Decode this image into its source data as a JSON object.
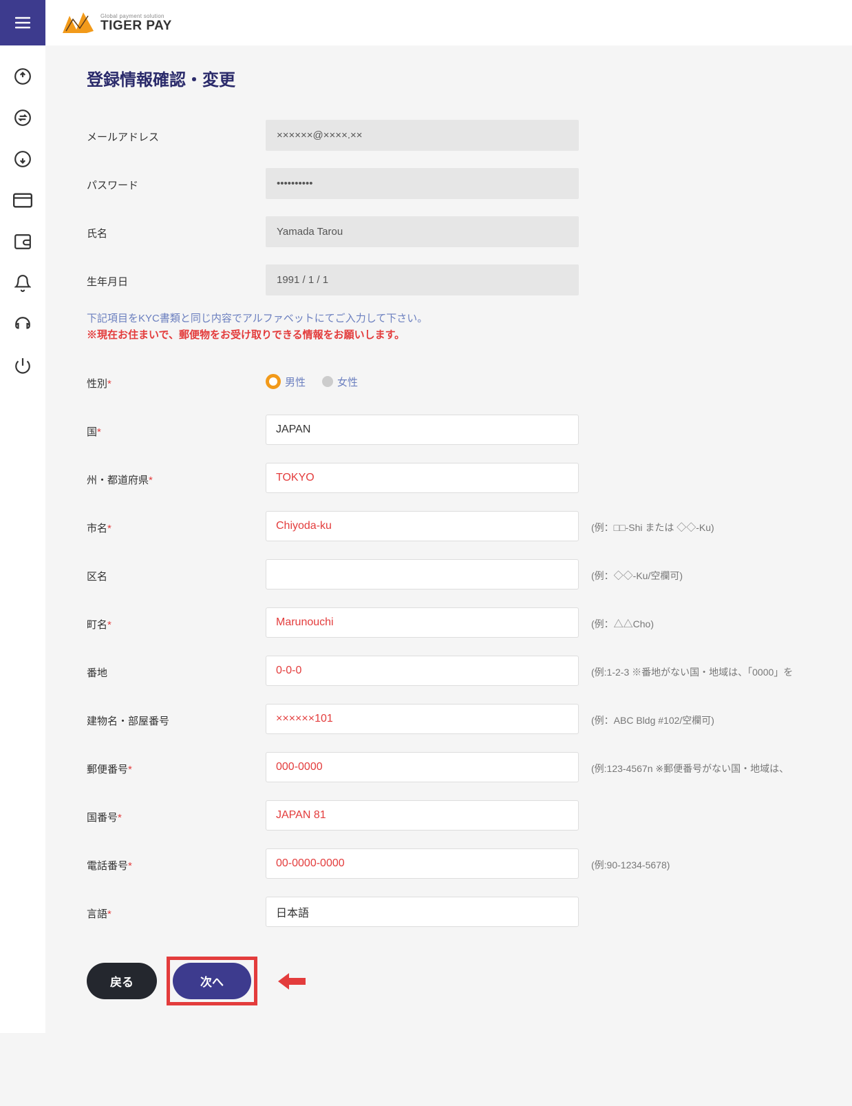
{
  "brand": {
    "tagline": "Global payment solution",
    "name": "TIGER PAY"
  },
  "page_title": "登録情報確認・変更",
  "readonly": {
    "email_label": "メールアドレス",
    "email_value": "××××××@××××.××",
    "password_label": "パスワード",
    "password_value": "••••••••••",
    "name_label": "氏名",
    "name_value": "Yamada Tarou",
    "dob_label": "生年月日",
    "dob_value": "1991 / 1 / 1"
  },
  "notice1": "下記項目をKYC書類と同じ内容でアルファベットにてご入力して下さい。",
  "notice2": "※現在お住まいで、郵便物をお受け取りできる情報をお願いします。",
  "fields": {
    "gender_label": "性別",
    "gender_male": "男性",
    "gender_female": "女性",
    "country_label": "国",
    "country_value": "JAPAN",
    "state_label": "州・都道府県",
    "state_value": "TOKYO",
    "city_label": "市名",
    "city_value": "Chiyoda-ku",
    "city_hint": "(例：□□-Shi または ◇◇-Ku)",
    "ward_label": "区名",
    "ward_value": "",
    "ward_hint": "(例：◇◇-Ku/空欄可)",
    "town_label": "町名",
    "town_value": "Marunouchi",
    "town_hint": "(例：△△Cho)",
    "block_label": "番地",
    "block_value": "0-0-0",
    "block_hint": "(例:1-2-3 ※番地がない国・地域は、「0000」を",
    "bldg_label": "建物名・部屋番号",
    "bldg_value": "××××××101",
    "bldg_hint": "(例：ABC Bldg #102/空欄可)",
    "postal_label": "郵便番号",
    "postal_value": "000-0000",
    "postal_hint": "(例:123-4567n ※郵便番号がない国・地域は、",
    "dialcode_label": "国番号",
    "dialcode_value": "JAPAN 81",
    "phone_label": "電話番号",
    "phone_value": "00-0000-0000",
    "phone_hint": "(例:90-1234-5678)",
    "lang_label": "言語",
    "lang_value": "日本語"
  },
  "buttons": {
    "back": "戻る",
    "next": "次へ"
  }
}
